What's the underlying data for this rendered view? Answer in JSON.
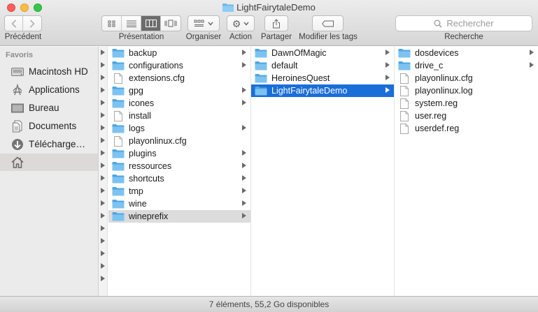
{
  "window": {
    "title": "LightFairytaleDemo"
  },
  "toolbar": {
    "back_label": "Précédent",
    "view_label": "Présentation",
    "arrange_label": "Organiser",
    "action_label": "Action",
    "share_label": "Partager",
    "tags_label": "Modifier les tags",
    "search_label": "Recherche",
    "search_placeholder": "Rechercher",
    "active_view": "columns"
  },
  "sidebar": {
    "heading": "Favoris",
    "items": [
      {
        "label": "Macintosh HD",
        "icon": "hard-drive-icon"
      },
      {
        "label": "Applications",
        "icon": "applications-icon"
      },
      {
        "label": "Bureau",
        "icon": "desktop-icon"
      },
      {
        "label": "Documents",
        "icon": "documents-icon"
      },
      {
        "label": "Télécharge…",
        "icon": "downloads-icon"
      },
      {
        "label": "",
        "icon": "home-icon",
        "selected": true
      }
    ]
  },
  "columns": [
    {
      "items": [
        {
          "name": "backup",
          "type": "folder",
          "arrow": true
        },
        {
          "name": "configurations",
          "type": "folder",
          "arrow": true
        },
        {
          "name": "extensions.cfg",
          "type": "file",
          "arrow": false
        },
        {
          "name": "gpg",
          "type": "folder",
          "arrow": true
        },
        {
          "name": "icones",
          "type": "folder",
          "arrow": true
        },
        {
          "name": "install",
          "type": "file",
          "arrow": false
        },
        {
          "name": "logs",
          "type": "folder",
          "arrow": true
        },
        {
          "name": "playonlinux.cfg",
          "type": "file",
          "arrow": false
        },
        {
          "name": "plugins",
          "type": "folder",
          "arrow": true
        },
        {
          "name": "ressources",
          "type": "folder",
          "arrow": true
        },
        {
          "name": "shortcuts",
          "type": "folder",
          "arrow": true
        },
        {
          "name": "tmp",
          "type": "folder",
          "arrow": true
        },
        {
          "name": "wine",
          "type": "folder",
          "arrow": true
        },
        {
          "name": "wineprefix",
          "type": "folder",
          "arrow": true,
          "selected": "gray"
        }
      ]
    },
    {
      "items": [
        {
          "name": "DawnOfMagic",
          "type": "folder",
          "arrow": true
        },
        {
          "name": "default",
          "type": "folder",
          "arrow": true
        },
        {
          "name": "HeroinesQuest",
          "type": "folder",
          "arrow": true
        },
        {
          "name": "LightFairytaleDemo",
          "type": "folder",
          "arrow": true,
          "selected": "blue"
        }
      ]
    },
    {
      "items": [
        {
          "name": "dosdevices",
          "type": "folder",
          "arrow": true
        },
        {
          "name": "drive_c",
          "type": "folder",
          "arrow": true
        },
        {
          "name": "playonlinux.cfg",
          "type": "file",
          "arrow": false
        },
        {
          "name": "playonlinux.log",
          "type": "file",
          "arrow": false
        },
        {
          "name": "system.reg",
          "type": "file",
          "arrow": false
        },
        {
          "name": "user.reg",
          "type": "file",
          "arrow": false
        },
        {
          "name": "userdef.reg",
          "type": "file",
          "arrow": false
        }
      ]
    }
  ],
  "status": {
    "text": "7 éléments, 55,2 Go disponibles"
  },
  "colors": {
    "folder": "#5fb2ea",
    "selection": "#1a6ed8"
  }
}
